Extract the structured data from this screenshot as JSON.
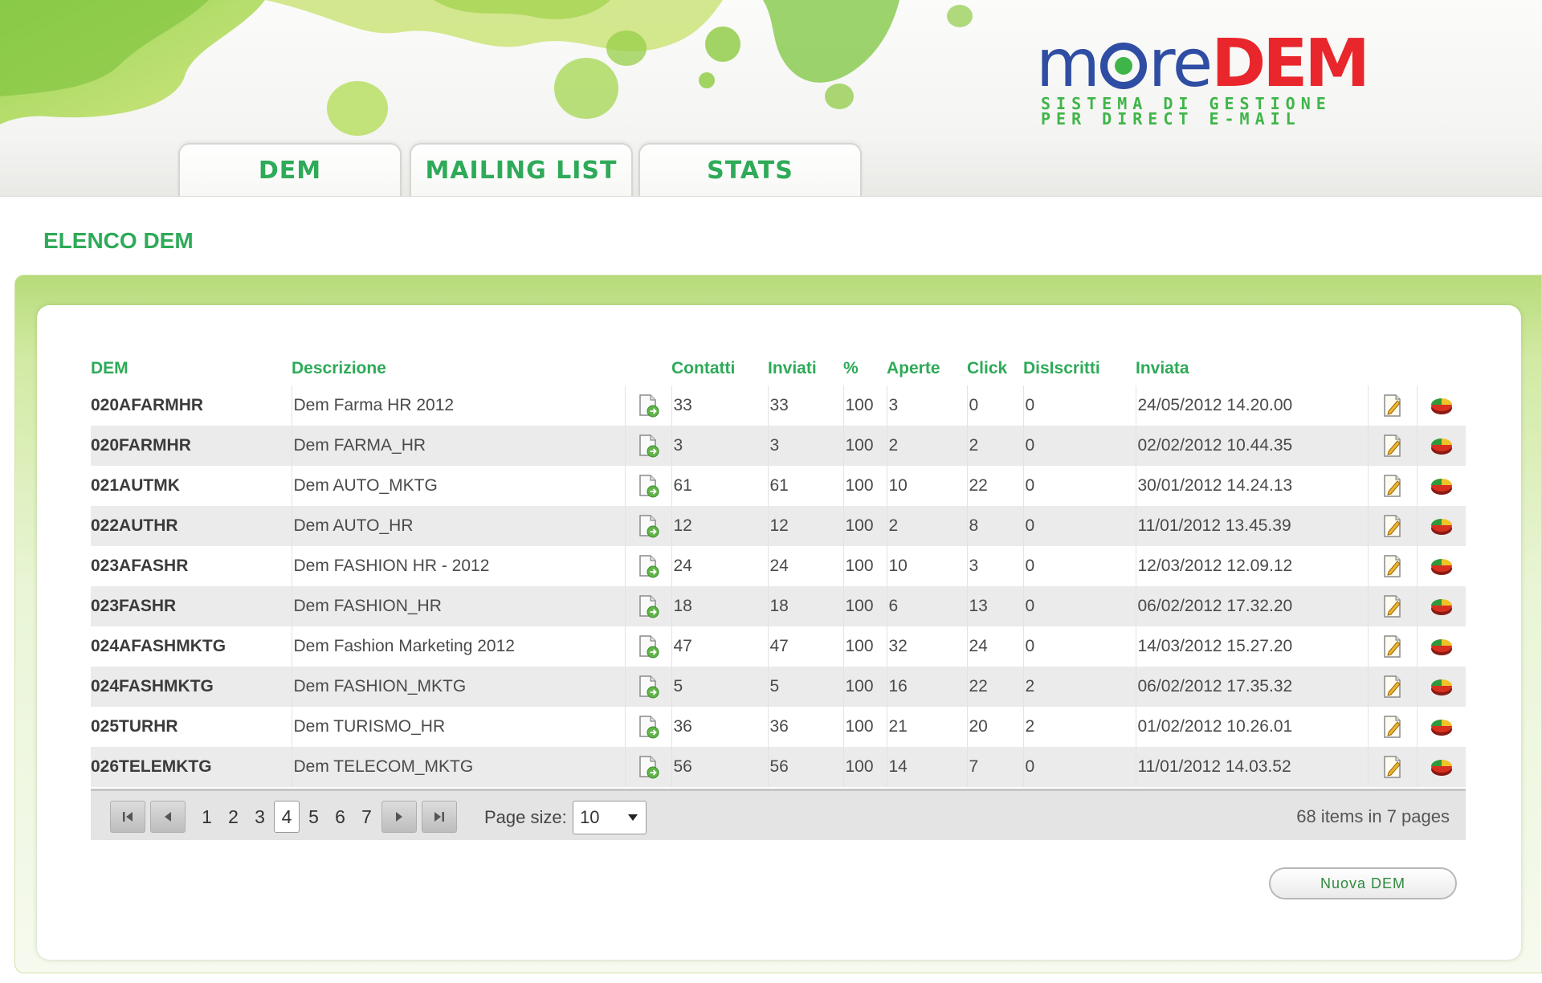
{
  "logo": {
    "part1": "m",
    "part2": "re",
    "part3": "DEM",
    "tagline_line1": "SISTEMA DI GESTIONE",
    "tagline_line2": "PER DIRECT E-MAIL"
  },
  "tabs": [
    {
      "label": "DEM"
    },
    {
      "label": "MAILING LIST"
    },
    {
      "label": "STATS"
    }
  ],
  "section_title": "ELENCO DEM",
  "columns": {
    "dem": "DEM",
    "descrizione": "Descrizione",
    "contatti": "Contatti",
    "inviati": "Inviati",
    "pct": "%",
    "aperte": "Aperte",
    "click": "Click",
    "disiscritti": "DisIscritti",
    "inviata": "Inviata"
  },
  "rows": [
    {
      "code": "020AFARMHR",
      "desc": "Dem Farma HR 2012",
      "contatti": "33",
      "inviati": "33",
      "pct": "100",
      "aperte": "3",
      "click": "0",
      "disiscritti": "0",
      "inviata": "24/05/2012 14.20.00"
    },
    {
      "code": "020FARMHR",
      "desc": "Dem FARMA_HR",
      "contatti": "3",
      "inviati": "3",
      "pct": "100",
      "aperte": "2",
      "click": "2",
      "disiscritti": "0",
      "inviata": "02/02/2012 10.44.35"
    },
    {
      "code": "021AUTMK",
      "desc": "Dem AUTO_MKTG",
      "contatti": "61",
      "inviati": "61",
      "pct": "100",
      "aperte": "10",
      "click": "22",
      "disiscritti": "0",
      "inviata": "30/01/2012 14.24.13"
    },
    {
      "code": "022AUTHR",
      "desc": "Dem AUTO_HR",
      "contatti": "12",
      "inviati": "12",
      "pct": "100",
      "aperte": "2",
      "click": "8",
      "disiscritti": "0",
      "inviata": "11/01/2012 13.45.39"
    },
    {
      "code": "023AFASHR",
      "desc": "Dem FASHION HR - 2012",
      "contatti": "24",
      "inviati": "24",
      "pct": "100",
      "aperte": "10",
      "click": "3",
      "disiscritti": "0",
      "inviata": "12/03/2012 12.09.12"
    },
    {
      "code": "023FASHR",
      "desc": "Dem FASHION_HR",
      "contatti": "18",
      "inviati": "18",
      "pct": "100",
      "aperte": "6",
      "click": "13",
      "disiscritti": "0",
      "inviata": "06/02/2012 17.32.20"
    },
    {
      "code": "024AFASHMKTG",
      "desc": "Dem Fashion Marketing 2012",
      "contatti": "47",
      "inviati": "47",
      "pct": "100",
      "aperte": "32",
      "click": "24",
      "disiscritti": "0",
      "inviata": "14/03/2012 15.27.20"
    },
    {
      "code": "024FASHMKTG",
      "desc": "Dem FASHION_MKTG",
      "contatti": "5",
      "inviati": "5",
      "pct": "100",
      "aperte": "16",
      "click": "22",
      "disiscritti": "2",
      "inviata": "06/02/2012 17.35.32"
    },
    {
      "code": "025TURHR",
      "desc": "Dem TURISMO_HR",
      "contatti": "36",
      "inviati": "36",
      "pct": "100",
      "aperte": "21",
      "click": "20",
      "disiscritti": "2",
      "inviata": "01/02/2012 10.26.01"
    },
    {
      "code": "026TELEMKTG",
      "desc": "Dem TELECOM_MKTG",
      "contatti": "56",
      "inviati": "56",
      "pct": "100",
      "aperte": "14",
      "click": "7",
      "disiscritti": "0",
      "inviata": "11/01/2012 14.03.52"
    }
  ],
  "pager": {
    "pages": [
      "1",
      "2",
      "3",
      "4",
      "5",
      "6",
      "7"
    ],
    "current_page": "4",
    "page_size_label": "Page size:",
    "page_size": "10",
    "info": "68 items in 7 pages"
  },
  "new_button": "Nuova DEM",
  "icons": {
    "row_send": "document-send-icon",
    "row_edit": "edit-document-icon",
    "row_stats": "pie-chart-icon"
  },
  "colors": {
    "accent_green": "#2eaa58",
    "logo_blue": "#2f4ea3",
    "logo_red": "#e8262b"
  }
}
